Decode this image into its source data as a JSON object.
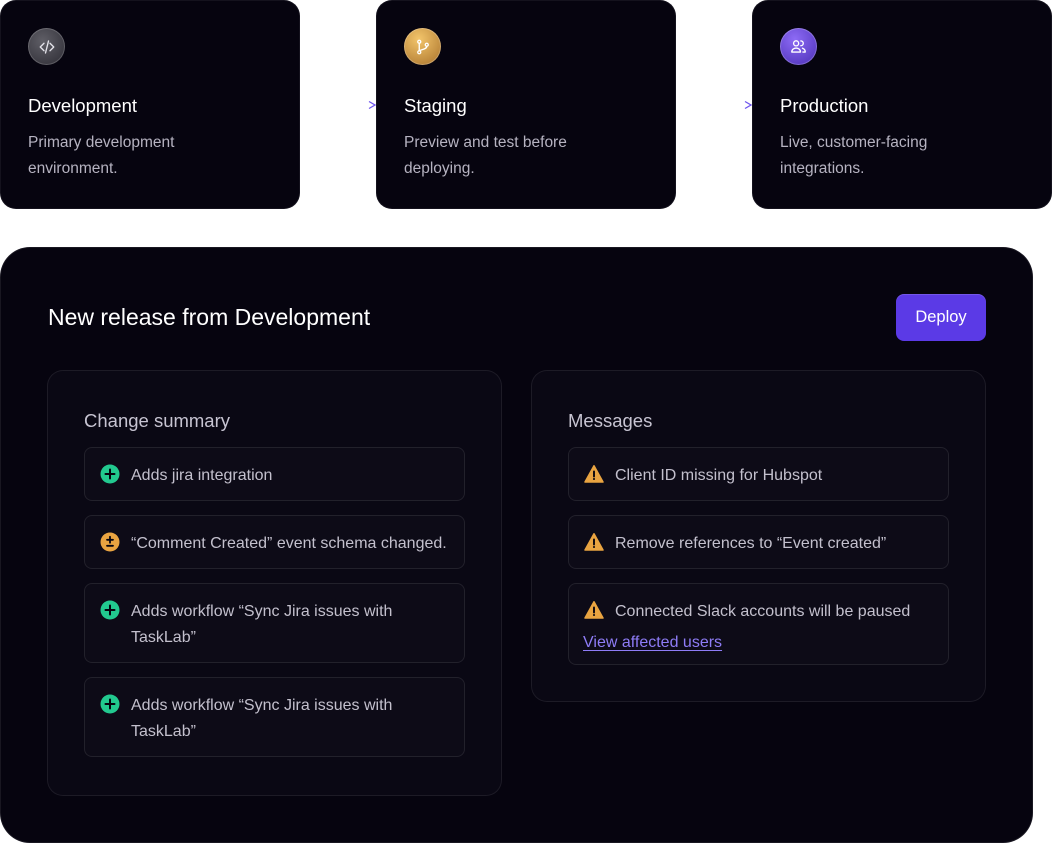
{
  "environments": [
    {
      "name": "Development",
      "description": "Primary development environment.",
      "icon": "code-icon"
    },
    {
      "name": "Staging",
      "description": "Preview and test before deploying.",
      "icon": "branch-icon"
    },
    {
      "name": "Production",
      "description": "Live, customer-facing integrations.",
      "icon": "users-icon"
    }
  ],
  "release": {
    "title": "New release from Development",
    "deploy_label": "Deploy"
  },
  "change_summary": {
    "title": "Change summary",
    "items": [
      {
        "text": "Adds jira integration",
        "type": "added"
      },
      {
        "text": "“Comment Created” event schema changed.",
        "type": "modified"
      },
      {
        "text": "Adds workflow “Sync Jira issues with TaskLab”",
        "type": "added"
      },
      {
        "text": "Adds workflow “Sync Jira issues with TaskLab”",
        "type": "added"
      }
    ]
  },
  "messages": {
    "title": "Messages",
    "items": [
      {
        "text": "Client ID missing for Hubspot",
        "type": "warning"
      },
      {
        "text": "Remove references to “Event created”",
        "type": "warning"
      },
      {
        "text": "Connected Slack accounts will be paused",
        "type": "warning",
        "link": "View affected users"
      }
    ]
  },
  "colors": {
    "accent": "#5b3ae6",
    "added": "#22c98f",
    "modified": "#e9a441",
    "warning": "#e9a441",
    "link": "#8e7cf6",
    "background": "#06040f"
  }
}
